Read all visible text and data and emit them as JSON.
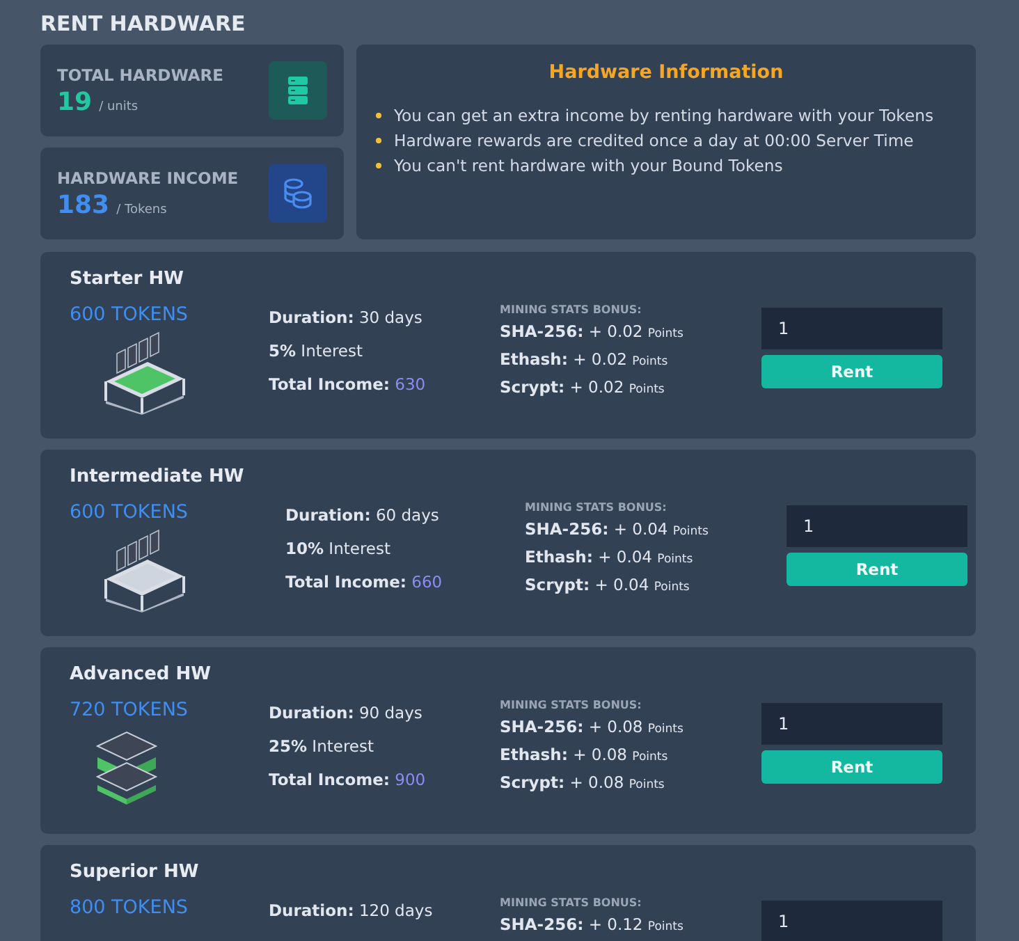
{
  "page_title": "RENT HARDWARE",
  "stats": [
    {
      "kind": "hardware",
      "label": "TOTAL HARDWARE",
      "value": "19",
      "unit": "/ units"
    },
    {
      "kind": "income",
      "label": "HARDWARE INCOME",
      "value": "183",
      "unit": "/ Tokens"
    }
  ],
  "info": {
    "title": "Hardware Information",
    "items": [
      "You can get an extra income by renting hardware with your Tokens",
      "Hardware rewards are credited once a day at 00:00 Server Time",
      "You can't rent hardware with your Bound Tokens"
    ]
  },
  "plans": [
    {
      "kind": "starter",
      "name": "Starter HW",
      "price": "600 TOKENS",
      "details": [
        {
          "kind": "text",
          "text": "**Duration:** 30 days"
        },
        {
          "kind": "text",
          "text": "**5%** Interest"
        },
        {
          "kind": "income",
          "label": "Total Income:",
          "value": "630"
        }
      ],
      "bonus_title": "MINING STATS BONUS:",
      "bonus": [
        {
          "algo": "SHA-256:",
          "value": "+ 0.02",
          "unit": "Points"
        },
        {
          "algo": "Ethash:",
          "value": "+ 0.02",
          "unit": "Points"
        },
        {
          "algo": "Scrypt:",
          "value": "+ 0.02",
          "unit": "Points"
        }
      ],
      "quantity": "1",
      "button": "Rent"
    },
    {
      "kind": "intermediate",
      "name": "Intermediate HW",
      "price": "600 TOKENS",
      "details": [
        {
          "kind": "text",
          "text": "**Duration:** 60 days"
        },
        {
          "kind": "text",
          "text": "**10%** Interest"
        },
        {
          "kind": "income",
          "label": "Total Income:",
          "value": "660"
        }
      ],
      "bonus_title": "MINING STATS BONUS:",
      "bonus": [
        {
          "algo": "SHA-256:",
          "value": "+ 0.04",
          "unit": "Points"
        },
        {
          "algo": "Ethash:",
          "value": "+ 0.04",
          "unit": "Points"
        },
        {
          "algo": "Scrypt:",
          "value": "+ 0.04",
          "unit": "Points"
        }
      ],
      "quantity": "1",
      "button": "Rent"
    },
    {
      "kind": "advanced",
      "name": "Advanced HW",
      "price": "720 TOKENS",
      "details": [
        {
          "kind": "text",
          "text": "**Duration:** 90 days"
        },
        {
          "kind": "text",
          "text": "**25%** Interest"
        },
        {
          "kind": "income",
          "label": "Total Income:",
          "value": "900"
        }
      ],
      "bonus_title": "MINING STATS BONUS:",
      "bonus": [
        {
          "algo": "SHA-256:",
          "value": "+ 0.08",
          "unit": "Points"
        },
        {
          "algo": "Ethash:",
          "value": "+ 0.08",
          "unit": "Points"
        },
        {
          "algo": "Scrypt:",
          "value": "+ 0.08",
          "unit": "Points"
        }
      ],
      "quantity": "1",
      "button": "Rent"
    },
    {
      "kind": "superior",
      "name": "Superior HW",
      "price": "800 TOKENS",
      "details": [
        {
          "kind": "text",
          "text": "**Duration:** 120 days"
        }
      ],
      "bonus_title": "MINING STATS BONUS:",
      "bonus": [
        {
          "algo": "SHA-256:",
          "value": "+ 0.12",
          "unit": "Points"
        }
      ],
      "quantity": "1"
    }
  ]
}
